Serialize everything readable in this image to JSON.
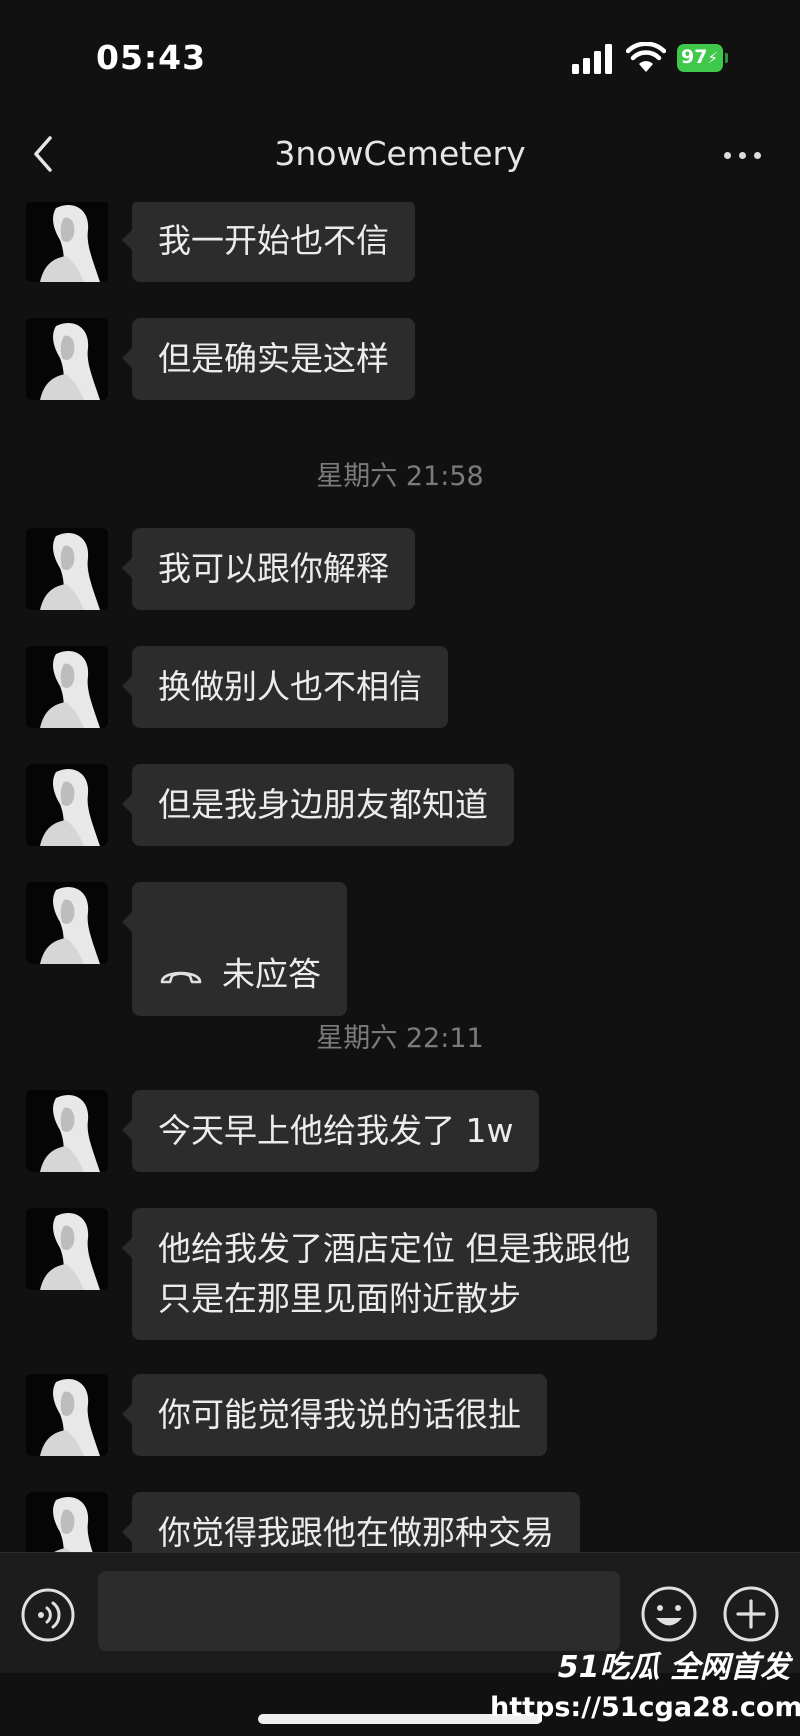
{
  "status_bar": {
    "time": "05:43",
    "battery": "97"
  },
  "nav": {
    "title": "3nowCemetery",
    "back_icon": "chevron-left-icon",
    "more_icon": "ellipsis-icon"
  },
  "messages": [
    {
      "type": "text",
      "text": "我一开始也不信"
    },
    {
      "type": "text",
      "text": "但是确实是这样"
    },
    {
      "type": "timestamp",
      "text": "星期六 21:58"
    },
    {
      "type": "text",
      "text": "我可以跟你解释"
    },
    {
      "type": "text",
      "text": "换做别人也不相信"
    },
    {
      "type": "text",
      "text": "但是我身边朋友都知道"
    },
    {
      "type": "call",
      "text": "未应答",
      "icon": "phone-missed-icon"
    },
    {
      "type": "timestamp",
      "text": "星期六 22:11"
    },
    {
      "type": "text",
      "text": "今天早上他给我发了 1w"
    },
    {
      "type": "text",
      "text": "他给我发了酒店定位 但是我跟他\n只是在那里见面附近散步"
    },
    {
      "type": "text",
      "text": "你可能觉得我说的话很扯"
    },
    {
      "type": "text",
      "text": "你觉得我跟他在做那种交易"
    }
  ],
  "input_bar": {
    "voice_icon": "voice-icon",
    "emoji_icon": "emoji-icon",
    "plus_icon": "plus-icon"
  },
  "watermark": {
    "brand": "51吃瓜 全网首发",
    "url": "https://51cga28.com"
  }
}
